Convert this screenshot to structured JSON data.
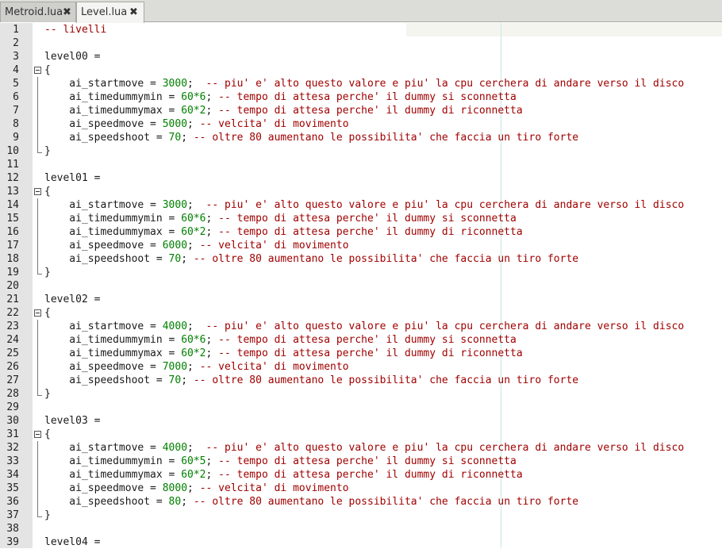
{
  "tabs": [
    {
      "label": "Metroid.lua",
      "active": false
    },
    {
      "label": "Level.lua",
      "active": true
    }
  ],
  "close_glyph": "✖",
  "lines": [
    {
      "n": "1",
      "fold": "",
      "parts": [
        [
          "cmt",
          "-- livelli"
        ]
      ]
    },
    {
      "n": "2",
      "fold": "",
      "parts": []
    },
    {
      "n": "3",
      "fold": "",
      "parts": [
        [
          "kw",
          "level00 ="
        ]
      ]
    },
    {
      "n": "4",
      "fold": "open",
      "parts": [
        [
          "kw",
          "{"
        ]
      ]
    },
    {
      "n": "5",
      "fold": "line",
      "parts": [
        [
          "kw",
          "    ai_startmove = "
        ],
        [
          "num",
          "3000"
        ],
        [
          "kw",
          ";  "
        ],
        [
          "cmt",
          "-- piu' e' alto questo valore e piu' la cpu cerchera di andare verso il disco"
        ]
      ]
    },
    {
      "n": "6",
      "fold": "line",
      "parts": [
        [
          "kw",
          "    ai_timedummymin = "
        ],
        [
          "num",
          "60*6"
        ],
        [
          "kw",
          "; "
        ],
        [
          "cmt",
          "-- tempo di attesa perche' il dummy si sconnetta"
        ]
      ]
    },
    {
      "n": "7",
      "fold": "line",
      "parts": [
        [
          "kw",
          "    ai_timedummymax = "
        ],
        [
          "num",
          "60*2"
        ],
        [
          "kw",
          "; "
        ],
        [
          "cmt",
          "-- tempo di attesa perche' il dummy di riconnetta"
        ]
      ]
    },
    {
      "n": "8",
      "fold": "line",
      "parts": [
        [
          "kw",
          "    ai_speedmove = "
        ],
        [
          "num",
          "5000"
        ],
        [
          "kw",
          "; "
        ],
        [
          "cmt",
          "-- velcita' di movimento"
        ]
      ]
    },
    {
      "n": "9",
      "fold": "line",
      "parts": [
        [
          "kw",
          "    ai_speedshoot = "
        ],
        [
          "num",
          "70"
        ],
        [
          "kw",
          "; "
        ],
        [
          "cmt",
          "-- oltre 80 aumentano le possibilita' che faccia un tiro forte"
        ]
      ]
    },
    {
      "n": "10",
      "fold": "end",
      "parts": [
        [
          "kw",
          "}"
        ]
      ]
    },
    {
      "n": "11",
      "fold": "",
      "parts": []
    },
    {
      "n": "12",
      "fold": "",
      "parts": [
        [
          "kw",
          "level01 ="
        ]
      ]
    },
    {
      "n": "13",
      "fold": "open",
      "parts": [
        [
          "kw",
          "{"
        ]
      ]
    },
    {
      "n": "14",
      "fold": "line",
      "parts": [
        [
          "kw",
          "    ai_startmove = "
        ],
        [
          "num",
          "3000"
        ],
        [
          "kw",
          ";  "
        ],
        [
          "cmt",
          "-- piu' e' alto questo valore e piu' la cpu cerchera di andare verso il disco"
        ]
      ]
    },
    {
      "n": "15",
      "fold": "line",
      "parts": [
        [
          "kw",
          "    ai_timedummymin = "
        ],
        [
          "num",
          "60*6"
        ],
        [
          "kw",
          "; "
        ],
        [
          "cmt",
          "-- tempo di attesa perche' il dummy si sconnetta"
        ]
      ]
    },
    {
      "n": "16",
      "fold": "line",
      "parts": [
        [
          "kw",
          "    ai_timedummymax = "
        ],
        [
          "num",
          "60*2"
        ],
        [
          "kw",
          "; "
        ],
        [
          "cmt",
          "-- tempo di attesa perche' il dummy di riconnetta"
        ]
      ]
    },
    {
      "n": "17",
      "fold": "line",
      "parts": [
        [
          "kw",
          "    ai_speedmove = "
        ],
        [
          "num",
          "6000"
        ],
        [
          "kw",
          "; "
        ],
        [
          "cmt",
          "-- velcita' di movimento"
        ]
      ]
    },
    {
      "n": "18",
      "fold": "line",
      "parts": [
        [
          "kw",
          "    ai_speedshoot = "
        ],
        [
          "num",
          "70"
        ],
        [
          "kw",
          "; "
        ],
        [
          "cmt",
          "-- oltre 80 aumentano le possibilita' che faccia un tiro forte"
        ]
      ]
    },
    {
      "n": "19",
      "fold": "end",
      "parts": [
        [
          "kw",
          "}"
        ]
      ]
    },
    {
      "n": "20",
      "fold": "",
      "parts": []
    },
    {
      "n": "21",
      "fold": "",
      "parts": [
        [
          "kw",
          "level02 ="
        ]
      ]
    },
    {
      "n": "22",
      "fold": "open",
      "parts": [
        [
          "kw",
          "{"
        ]
      ]
    },
    {
      "n": "23",
      "fold": "line",
      "parts": [
        [
          "kw",
          "    ai_startmove = "
        ],
        [
          "num",
          "4000"
        ],
        [
          "kw",
          ";  "
        ],
        [
          "cmt",
          "-- piu' e' alto questo valore e piu' la cpu cerchera di andare verso il disco"
        ]
      ]
    },
    {
      "n": "24",
      "fold": "line",
      "parts": [
        [
          "kw",
          "    ai_timedummymin = "
        ],
        [
          "num",
          "60*6"
        ],
        [
          "kw",
          "; "
        ],
        [
          "cmt",
          "-- tempo di attesa perche' il dummy si sconnetta"
        ]
      ]
    },
    {
      "n": "25",
      "fold": "line",
      "parts": [
        [
          "kw",
          "    ai_timedummymax = "
        ],
        [
          "num",
          "60*2"
        ],
        [
          "kw",
          "; "
        ],
        [
          "cmt",
          "-- tempo di attesa perche' il dummy di riconnetta"
        ]
      ]
    },
    {
      "n": "26",
      "fold": "line",
      "parts": [
        [
          "kw",
          "    ai_speedmove = "
        ],
        [
          "num",
          "7000"
        ],
        [
          "kw",
          "; "
        ],
        [
          "cmt",
          "-- velcita' di movimento"
        ]
      ]
    },
    {
      "n": "27",
      "fold": "line",
      "parts": [
        [
          "kw",
          "    ai_speedshoot = "
        ],
        [
          "num",
          "70"
        ],
        [
          "kw",
          "; "
        ],
        [
          "cmt",
          "-- oltre 80 aumentano le possibilita' che faccia un tiro forte"
        ]
      ]
    },
    {
      "n": "28",
      "fold": "end",
      "parts": [
        [
          "kw",
          "}"
        ]
      ]
    },
    {
      "n": "29",
      "fold": "",
      "parts": []
    },
    {
      "n": "30",
      "fold": "",
      "parts": [
        [
          "kw",
          "level03 ="
        ]
      ]
    },
    {
      "n": "31",
      "fold": "open",
      "parts": [
        [
          "kw",
          "{"
        ]
      ]
    },
    {
      "n": "32",
      "fold": "line",
      "parts": [
        [
          "kw",
          "    ai_startmove = "
        ],
        [
          "num",
          "4000"
        ],
        [
          "kw",
          ";  "
        ],
        [
          "cmt",
          "-- piu' e' alto questo valore e piu' la cpu cerchera di andare verso il disco"
        ]
      ]
    },
    {
      "n": "33",
      "fold": "line",
      "parts": [
        [
          "kw",
          "    ai_timedummymin = "
        ],
        [
          "num",
          "60*5"
        ],
        [
          "kw",
          "; "
        ],
        [
          "cmt",
          "-- tempo di attesa perche' il dummy si sconnetta"
        ]
      ]
    },
    {
      "n": "34",
      "fold": "line",
      "parts": [
        [
          "kw",
          "    ai_timedummymax = "
        ],
        [
          "num",
          "60*2"
        ],
        [
          "kw",
          "; "
        ],
        [
          "cmt",
          "-- tempo di attesa perche' il dummy di riconnetta"
        ]
      ]
    },
    {
      "n": "35",
      "fold": "line",
      "parts": [
        [
          "kw",
          "    ai_speedmove = "
        ],
        [
          "num",
          "8000"
        ],
        [
          "kw",
          "; "
        ],
        [
          "cmt",
          "-- velcita' di movimento"
        ]
      ]
    },
    {
      "n": "36",
      "fold": "line",
      "parts": [
        [
          "kw",
          "    ai_speedshoot = "
        ],
        [
          "num",
          "80"
        ],
        [
          "kw",
          "; "
        ],
        [
          "cmt",
          "-- oltre 80 aumentano le possibilita' che faccia un tiro forte"
        ]
      ]
    },
    {
      "n": "37",
      "fold": "end",
      "parts": [
        [
          "kw",
          "}"
        ]
      ]
    },
    {
      "n": "38",
      "fold": "",
      "parts": []
    },
    {
      "n": "39",
      "fold": "",
      "parts": [
        [
          "kw",
          "level04 ="
        ]
      ]
    }
  ]
}
